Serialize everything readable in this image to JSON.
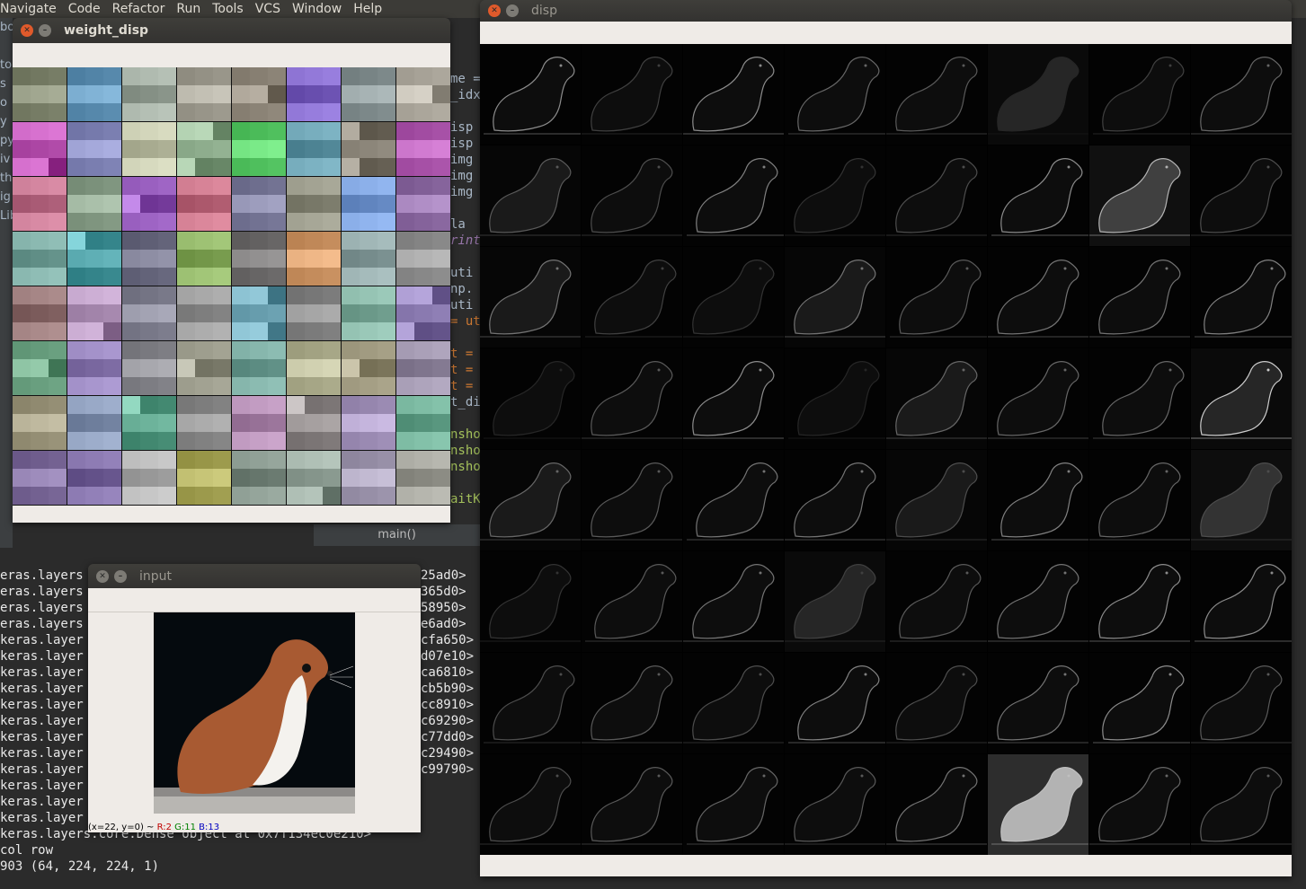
{
  "menu": [
    "Navigate",
    "Code",
    "Refactor",
    "Run",
    "Tools",
    "VCS",
    "Window",
    "Help"
  ],
  "ide": {
    "left_strip": [
      "bo:",
      "",
      "to",
      "s",
      "o",
      "y",
      "py",
      "iv",
      "th",
      "ig",
      "Lib"
    ],
    "code_fragments": [
      "me =",
      "_idx",
      "",
      "isp",
      "isp",
      "img",
      "img",
      "img",
      "",
      "la",
      "rint",
      "",
      "uti",
      "np.",
      "uti",
      "= ut",
      "",
      "t =",
      "t =",
      "t =",
      "t_di",
      "",
      "nsho",
      "nsho",
      "nsho",
      "",
      "aitK"
    ],
    "breadcrumb": "main()"
  },
  "console": {
    "lines": [
      {
        "left": "eras.layers",
        "right": "25ad0>"
      },
      {
        "left": "eras.layers",
        "right": "365d0>"
      },
      {
        "left": "eras.layers",
        "right": "58950>"
      },
      {
        "left": "eras.layers",
        "right": "e6ad0>"
      },
      {
        "left": "keras.layer",
        "right": "cfa650>"
      },
      {
        "left": "keras.layer",
        "right": "d07e10>"
      },
      {
        "left": "keras.layer",
        "right": "ca6810>"
      },
      {
        "left": "keras.layer",
        "right": "cb5b90>"
      },
      {
        "left": "keras.layer",
        "right": "cc8910>"
      },
      {
        "left": "keras.layer",
        "right": "c69290>"
      },
      {
        "left": "keras.layer",
        "right": "c77dd0>"
      },
      {
        "left": "keras.layer",
        "right": "c29490>"
      },
      {
        "left": "keras.layer",
        "right": "c99790>"
      },
      {
        "left": "keras.layer",
        "right": ""
      },
      {
        "left": "keras.layer",
        "right": ""
      },
      {
        "left": "keras.layer",
        "right": ""
      }
    ],
    "tail": [
      "keras.layers.core.Dense object at 0x7f134ec0e210>",
      "col row",
      "903 (64, 224, 224, 1)"
    ]
  },
  "windows": {
    "weight": {
      "title": "weight_disp"
    },
    "disp": {
      "title": "disp"
    },
    "input": {
      "title": "input",
      "status_prefix": "(x=22, y=0) ~ ",
      "status_r": "R:2",
      "status_g": "G:11",
      "status_b": "B:13"
    }
  },
  "colors": {
    "accent_close": "#e05a2b",
    "canvas": "#efebe7"
  },
  "weight_palette": [
    [
      "#9aa089",
      "#5b8db0",
      "#9aa59a",
      "#b9b6aa",
      "#8d8578",
      "#7a60c0",
      "#9aa6a7",
      "#aaa59a"
    ],
    [
      "#b04aa8",
      "#8a8ec0",
      "#c8cbb0",
      "#8fae8e",
      "#5ccc6a",
      "#6aa0b0",
      "#8a8478",
      "#b05ab0"
    ],
    [
      "#b86a84",
      "#9ab09a",
      "#9a60c0",
      "#b86478",
      "#8a8aaa",
      "#a0a090",
      "#6a8ec8",
      "#9a78b0"
    ],
    [
      "#7aa8a0",
      "#5aaab0",
      "#6a6a80",
      "#8aae60",
      "#8a8888",
      "#c89060",
      "#8aa0a0",
      "#a8a8a8"
    ],
    [
      "#a08080",
      "#a88ab0",
      "#8a8a9a",
      "#a0a0a0",
      "#6aa0b0",
      "#8a8a8a",
      "#8ab8a8",
      "#8a7ab0"
    ],
    [
      "#6aa080",
      "#8a78b0",
      "#9a9aa0",
      "#a0a090",
      "#6a9a90",
      "#c0c0a0",
      "#a09a80",
      "#8a8098"
    ],
    [
      "#a09a80",
      "#8a9ab8",
      "#6ab098",
      "#8a8a8a",
      "#b08ab0",
      "#a09a9a",
      "#a090b8",
      "#6aa890"
    ],
    [
      "#8a78a8",
      "#8a78b0",
      "#a0a0a0",
      "#b0ae60",
      "#8a9a90",
      "#8a9a90",
      "#a8a0b8",
      "#a8a8a0"
    ]
  ],
  "fmap_brightness": [
    [
      0.55,
      0.25,
      0.55,
      0.4,
      0.35,
      0.15,
      0.25,
      0.4
    ],
    [
      0.35,
      0.3,
      0.5,
      0.2,
      0.3,
      0.55,
      0.7,
      0.3
    ],
    [
      0.45,
      0.25,
      0.2,
      0.45,
      0.35,
      0.45,
      0.45,
      0.5
    ],
    [
      0.15,
      0.35,
      0.55,
      0.15,
      0.4,
      0.4,
      0.4,
      0.8
    ],
    [
      0.4,
      0.35,
      0.45,
      0.45,
      0.3,
      0.5,
      0.4,
      0.3
    ],
    [
      0.2,
      0.35,
      0.45,
      0.25,
      0.35,
      0.45,
      0.55,
      0.55
    ],
    [
      0.3,
      0.35,
      0.3,
      0.5,
      0.3,
      0.45,
      0.55,
      0.35
    ],
    [
      0.3,
      0.35,
      0.4,
      0.35,
      0.45,
      0.75,
      0.4,
      0.35
    ]
  ],
  "fmap_fill": [
    [
      0.05,
      0.05,
      0.05,
      0.05,
      0.05,
      0.15,
      0.05,
      0.05
    ],
    [
      0.1,
      0.05,
      0.05,
      0.05,
      0.05,
      0.05,
      0.25,
      0.05
    ],
    [
      0.1,
      0.05,
      0.05,
      0.1,
      0.05,
      0.05,
      0.05,
      0.05
    ],
    [
      0.05,
      0.05,
      0.05,
      0.05,
      0.1,
      0.05,
      0.05,
      0.15
    ],
    [
      0.1,
      0.05,
      0.05,
      0.05,
      0.1,
      0.05,
      0.05,
      0.2
    ],
    [
      0.05,
      0.05,
      0.05,
      0.15,
      0.05,
      0.05,
      0.05,
      0.05
    ],
    [
      0.05,
      0.05,
      0.05,
      0.05,
      0.05,
      0.05,
      0.05,
      0.05
    ],
    [
      0.05,
      0.05,
      0.05,
      0.05,
      0.05,
      0.7,
      0.05,
      0.05
    ]
  ]
}
